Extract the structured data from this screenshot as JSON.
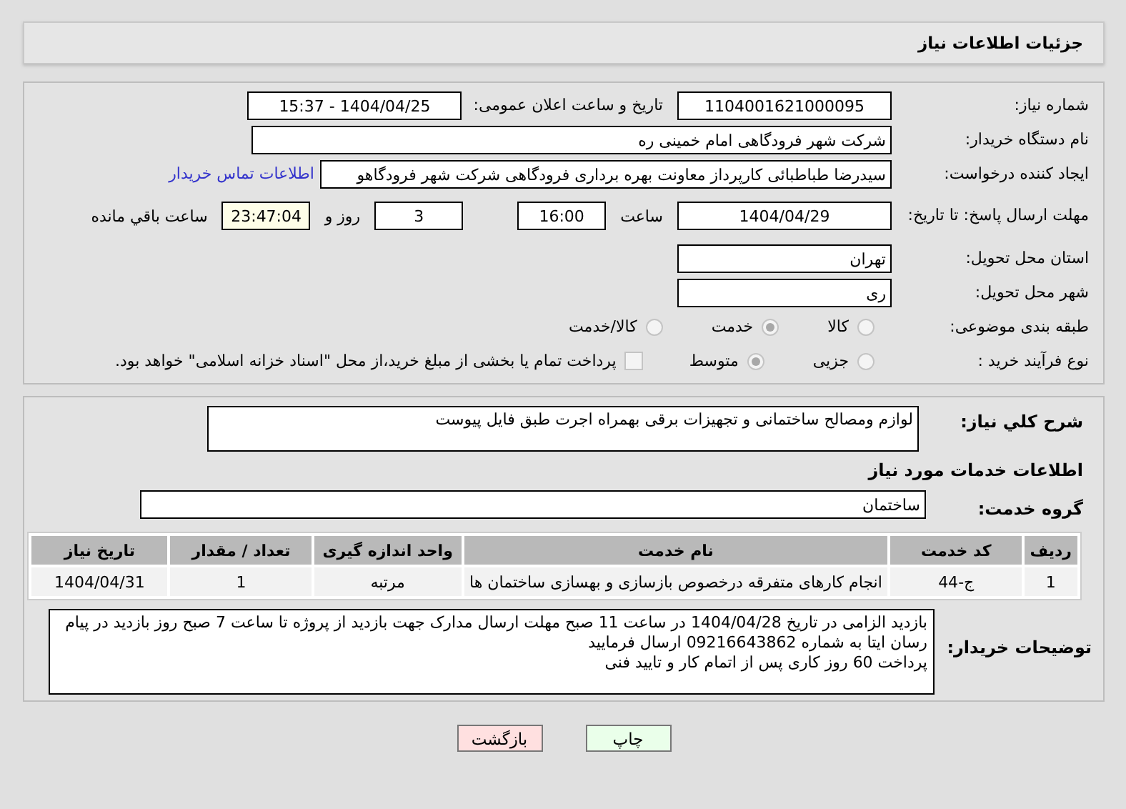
{
  "header": {
    "title": "جزئیات اطلاعات نیاز"
  },
  "form": {
    "need_number": {
      "label": "شماره نیاز:",
      "value": "1104001621000095"
    },
    "announce": {
      "label": "تاریخ و ساعت اعلان عمومی:",
      "value": "1404/04/25 - 15:37"
    },
    "buyer": {
      "label": "نام دستگاه خریدار:",
      "value": "شرکت شهر فرودگاهی امام خمینی  ره"
    },
    "creator": {
      "label": "ایجاد کننده درخواست:",
      "value": "سیدرضا طباطبائی کارپرداز معاونت بهره برداری فرودگاهی شرکت شهر فرودگاهو",
      "link": "اطلاعات تماس خریدار"
    },
    "deadline": {
      "label": "مهلت ارسال پاسخ: تا تاریخ:",
      "date": "1404/04/29",
      "time_label": "ساعت",
      "time": "16:00",
      "days": "3",
      "days_label": "روز و",
      "remaining": "23:47:04",
      "remaining_label": "ساعت باقي مانده"
    },
    "province": {
      "label": "استان محل تحویل:",
      "value": "تهران"
    },
    "city": {
      "label": "شهر محل تحویل:",
      "value": "ری"
    },
    "category": {
      "label": "طبقه بندی موضوعی:",
      "options": [
        {
          "label": "کالا",
          "selected": false
        },
        {
          "label": "خدمت",
          "selected": true
        },
        {
          "label": "کالا/خدمت",
          "selected": false
        }
      ]
    },
    "process": {
      "label": "نوع فرآیند خرید :",
      "options": [
        {
          "label": "جزیی",
          "selected": false
        },
        {
          "label": "متوسط",
          "selected": true
        }
      ],
      "treasury": {
        "label": "پرداخت تمام یا بخشی از مبلغ خرید،از محل \"اسناد خزانه اسلامی\" خواهد بود.",
        "checked": false
      }
    }
  },
  "details": {
    "summary": {
      "label": "شرح کلي نیاز:",
      "value": "لوازم ومصالح ساختمانی  و تجهیزات برقی بهمراه اجرت طبق فایل پیوست"
    },
    "services_title": "اطلاعات خدمات مورد نیاز",
    "group": {
      "label": "گروه خدمت:",
      "value": "ساختمان"
    },
    "table": {
      "columns": [
        "ردیف",
        "کد خدمت",
        "نام خدمت",
        "واحد اندازه گیری",
        "تعداد / مقدار",
        "تاریخ نیاز"
      ],
      "rows": [
        [
          "1",
          "ج-44",
          "انجام کارهای متفرقه درخصوص بازسازی و بهسازی ساختمان ها",
          "مرتبه",
          "1",
          "1404/04/31"
        ]
      ]
    },
    "notes": {
      "label": "توضیحات خریدار:",
      "paragraphs": [
        "بازدید الزامی در تاریخ 1404/04/28 در ساعت 11 صبح مهلت ارسال مدارک جهت بازدید از پروژه تا ساعت 7 صبح روز بازدید در پیام رسان ایتا به شماره 09216643862 ارسال فرمایید",
        "پرداخت 60 روز کاری پس از اتمام کار و تایید فنی"
      ]
    }
  },
  "buttons": [
    {
      "label": "چاپ",
      "kind": "print"
    },
    {
      "label": "بازگشت",
      "kind": "back"
    }
  ]
}
